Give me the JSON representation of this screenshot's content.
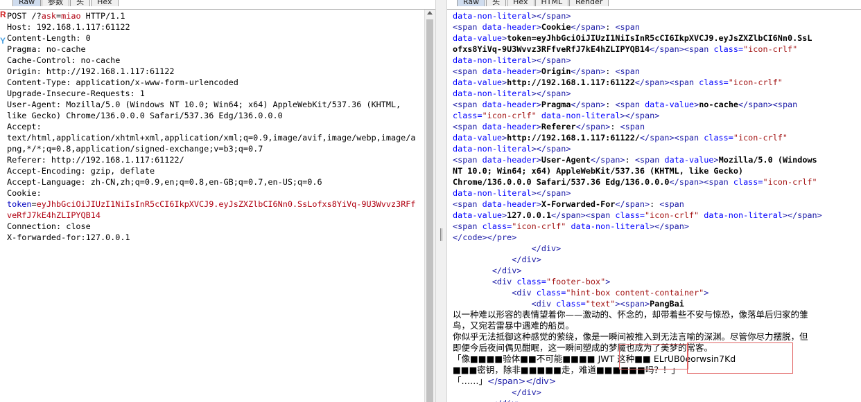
{
  "left_tabs": [
    "Raw",
    "参数",
    "头",
    "Hex"
  ],
  "right_tabs": [
    "Raw",
    "头",
    "Hex",
    "HTML",
    "Render"
  ],
  "left_edge_marks": [
    "R",
    "Y"
  ],
  "request": {
    "lines": [
      {
        "segments": [
          {
            "t": "POST /?",
            "c": ""
          },
          {
            "t": "ask",
            "c": "red"
          },
          {
            "t": "=",
            "c": ""
          },
          {
            "t": "miao",
            "c": "red"
          },
          {
            "t": " HTTP/1.1",
            "c": ""
          }
        ]
      },
      {
        "segments": [
          {
            "t": "Host: 192.168.1.117:61122",
            "c": ""
          }
        ]
      },
      {
        "segments": [
          {
            "t": "Content-Length: 0",
            "c": ""
          }
        ]
      },
      {
        "segments": [
          {
            "t": "Pragma: no-cache",
            "c": ""
          }
        ]
      },
      {
        "segments": [
          {
            "t": "Cache-Control: no-cache",
            "c": ""
          }
        ]
      },
      {
        "segments": [
          {
            "t": "Origin: http://192.168.1.117:61122",
            "c": ""
          }
        ]
      },
      {
        "segments": [
          {
            "t": "Content-Type: application/x-www-form-urlencoded",
            "c": ""
          }
        ]
      },
      {
        "segments": [
          {
            "t": "Upgrade-Insecure-Requests: 1",
            "c": ""
          }
        ]
      },
      {
        "segments": [
          {
            "t": "User-Agent: Mozilla/5.0 (Windows NT 10.0; Win64; x64) AppleWebKit/537.36 (KHTML,",
            "c": ""
          }
        ]
      },
      {
        "segments": [
          {
            "t": "like Gecko) Chrome/136.0.0.0 Safari/537.36 Edg/136.0.0.0",
            "c": ""
          }
        ]
      },
      {
        "segments": [
          {
            "t": "Accept:",
            "c": ""
          }
        ]
      },
      {
        "segments": [
          {
            "t": "text/html,application/xhtml+xml,application/xml;q=0.9,image/avif,image/webp,image/a",
            "c": ""
          }
        ]
      },
      {
        "segments": [
          {
            "t": "png,*/*;q=0.8,application/signed-exchange;v=b3;q=0.7",
            "c": ""
          }
        ]
      },
      {
        "segments": [
          {
            "t": "Referer: http://192.168.1.117:61122/",
            "c": ""
          }
        ]
      },
      {
        "segments": [
          {
            "t": "Accept-Encoding: gzip, deflate",
            "c": ""
          }
        ]
      },
      {
        "segments": [
          {
            "t": "Accept-Language: zh-CN,zh;q=0.9,en;q=0.8,en-GB;q=0.7,en-US;q=0.6",
            "c": ""
          }
        ]
      },
      {
        "segments": [
          {
            "t": "Cookie:",
            "c": ""
          }
        ]
      },
      {
        "segments": [
          {
            "t": "token",
            "c": "blue"
          },
          {
            "t": "=",
            "c": ""
          },
          {
            "t": "eyJhbGciOiJIUzI1NiIsInR5cCI6IkpXVCJ9.eyJsZXZlbCI6Nn0.SsLofxs8YiVq-9U3Wvvz3RFf",
            "c": "red"
          }
        ]
      },
      {
        "segments": [
          {
            "t": "veRfJ7kE4hZLIPYQB14",
            "c": "red"
          }
        ]
      },
      {
        "segments": [
          {
            "t": "Connection: close",
            "c": ""
          }
        ]
      },
      {
        "segments": [
          {
            "t": "X-forwarded-for:127.0.0.1",
            "c": ""
          }
        ]
      }
    ]
  },
  "response": {
    "lines": [
      {
        "indent": "",
        "segments": [
          {
            "t": "data-non-literal",
            "c": "attr"
          },
          {
            "t": "></",
            "c": "tag"
          },
          {
            "t": "span",
            "c": "tag"
          },
          {
            "t": ">",
            "c": "tag"
          }
        ]
      },
      {
        "indent": "",
        "segments": [
          {
            "t": "<span ",
            "c": "tag"
          },
          {
            "t": "data-header",
            "c": "attr"
          },
          {
            "t": ">",
            "c": "tag"
          },
          {
            "t": "Cookie",
            "c": "txt"
          },
          {
            "t": "</span>",
            "c": "tag"
          },
          {
            "t": ": ",
            "c": ""
          },
          {
            "t": "<span",
            "c": "tag"
          }
        ]
      },
      {
        "indent": "",
        "segments": [
          {
            "t": "data-value",
            "c": "attr"
          },
          {
            "t": ">",
            "c": "tag"
          },
          {
            "t": "token=eyJhbGciOiJIUzI1NiIsInR5cCI6IkpXVCJ9.eyJsZXZlbCI6Nn0.SsL",
            "c": "txt"
          }
        ]
      },
      {
        "indent": "",
        "segments": [
          {
            "t": "ofxs8YiVq-9U3Wvvz3RFfveRfJ7kE4hZLIPYQB14",
            "c": "txt"
          },
          {
            "t": "</span>",
            "c": "tag"
          },
          {
            "t": "<span ",
            "c": "tag"
          },
          {
            "t": "class=",
            "c": "attr"
          },
          {
            "t": "\"icon-crlf\"",
            "c": "str"
          }
        ]
      },
      {
        "indent": "",
        "segments": [
          {
            "t": "data-non-literal",
            "c": "attr"
          },
          {
            "t": "></span>",
            "c": "tag"
          }
        ]
      },
      {
        "indent": "",
        "segments": [
          {
            "t": "<span ",
            "c": "tag"
          },
          {
            "t": "data-header",
            "c": "attr"
          },
          {
            "t": ">",
            "c": "tag"
          },
          {
            "t": "Origin",
            "c": "txt"
          },
          {
            "t": "</span>",
            "c": "tag"
          },
          {
            "t": ": ",
            "c": ""
          },
          {
            "t": "<span",
            "c": "tag"
          }
        ]
      },
      {
        "indent": "",
        "segments": [
          {
            "t": "data-value",
            "c": "attr"
          },
          {
            "t": ">",
            "c": "tag"
          },
          {
            "t": "http://192.168.1.117:61122",
            "c": "txt"
          },
          {
            "t": "</span>",
            "c": "tag"
          },
          {
            "t": "<span ",
            "c": "tag"
          },
          {
            "t": "class=",
            "c": "attr"
          },
          {
            "t": "\"icon-crlf\"",
            "c": "str"
          }
        ]
      },
      {
        "indent": "",
        "segments": [
          {
            "t": "data-non-literal",
            "c": "attr"
          },
          {
            "t": "></span>",
            "c": "tag"
          }
        ]
      },
      {
        "indent": "",
        "segments": [
          {
            "t": "<span ",
            "c": "tag"
          },
          {
            "t": "data-header",
            "c": "attr"
          },
          {
            "t": ">",
            "c": "tag"
          },
          {
            "t": "Pragma",
            "c": "txt"
          },
          {
            "t": "</span>",
            "c": "tag"
          },
          {
            "t": ": ",
            "c": ""
          },
          {
            "t": "<span ",
            "c": "tag"
          },
          {
            "t": "data-value",
            "c": "attr"
          },
          {
            "t": ">",
            "c": "tag"
          },
          {
            "t": "no-cache",
            "c": "txt"
          },
          {
            "t": "</span>",
            "c": "tag"
          },
          {
            "t": "<span",
            "c": "tag"
          }
        ]
      },
      {
        "indent": "",
        "segments": [
          {
            "t": "class=",
            "c": "attr"
          },
          {
            "t": "\"icon-crlf\"",
            "c": "str"
          },
          {
            "t": " data-non-literal",
            "c": "attr"
          },
          {
            "t": "></span>",
            "c": "tag"
          }
        ]
      },
      {
        "indent": "",
        "segments": [
          {
            "t": "<span ",
            "c": "tag"
          },
          {
            "t": "data-header",
            "c": "attr"
          },
          {
            "t": ">",
            "c": "tag"
          },
          {
            "t": "Referer",
            "c": "txt"
          },
          {
            "t": "</span>",
            "c": "tag"
          },
          {
            "t": ": ",
            "c": ""
          },
          {
            "t": "<span",
            "c": "tag"
          }
        ]
      },
      {
        "indent": "",
        "segments": [
          {
            "t": "data-value",
            "c": "attr"
          },
          {
            "t": ">",
            "c": "tag"
          },
          {
            "t": "http://192.168.1.117:61122/",
            "c": "txt"
          },
          {
            "t": "</span>",
            "c": "tag"
          },
          {
            "t": "<span ",
            "c": "tag"
          },
          {
            "t": "class=",
            "c": "attr"
          },
          {
            "t": "\"icon-crlf\"",
            "c": "str"
          }
        ]
      },
      {
        "indent": "",
        "segments": [
          {
            "t": "data-non-literal",
            "c": "attr"
          },
          {
            "t": "></span>",
            "c": "tag"
          }
        ]
      },
      {
        "indent": "",
        "segments": [
          {
            "t": "<span ",
            "c": "tag"
          },
          {
            "t": "data-header",
            "c": "attr"
          },
          {
            "t": ">",
            "c": "tag"
          },
          {
            "t": "User-Agent",
            "c": "txt"
          },
          {
            "t": "</span>",
            "c": "tag"
          },
          {
            "t": ": ",
            "c": ""
          },
          {
            "t": "<span ",
            "c": "tag"
          },
          {
            "t": "data-value",
            "c": "attr"
          },
          {
            "t": ">",
            "c": "tag"
          },
          {
            "t": "Mozilla/5.0 (Windows",
            "c": "txt"
          }
        ]
      },
      {
        "indent": "",
        "segments": [
          {
            "t": "NT 10.0; Win64; x64) AppleWebKit/537.36 (KHTML, like Gecko)",
            "c": "txt"
          }
        ]
      },
      {
        "indent": "",
        "segments": [
          {
            "t": "Chrome/136.0.0.0 Safari/537.36 Edg/136.0.0.0",
            "c": "txt"
          },
          {
            "t": "</span>",
            "c": "tag"
          },
          {
            "t": "<span ",
            "c": "tag"
          },
          {
            "t": "class=",
            "c": "attr"
          },
          {
            "t": "\"icon-crlf\"",
            "c": "str"
          }
        ]
      },
      {
        "indent": "",
        "segments": [
          {
            "t": "data-non-literal",
            "c": "attr"
          },
          {
            "t": "></span>",
            "c": "tag"
          }
        ]
      },
      {
        "indent": "",
        "segments": [
          {
            "t": "<span ",
            "c": "tag"
          },
          {
            "t": "data-header",
            "c": "attr"
          },
          {
            "t": ">",
            "c": "tag"
          },
          {
            "t": "X-Forwarded-For",
            "c": "txt"
          },
          {
            "t": "</span>",
            "c": "tag"
          },
          {
            "t": ": ",
            "c": ""
          },
          {
            "t": "<span",
            "c": "tag"
          }
        ]
      },
      {
        "indent": "",
        "segments": [
          {
            "t": "data-value",
            "c": "attr"
          },
          {
            "t": ">",
            "c": "tag"
          },
          {
            "t": "127.0.0.1",
            "c": "txt"
          },
          {
            "t": "</span>",
            "c": "tag"
          },
          {
            "t": "<span ",
            "c": "tag"
          },
          {
            "t": "class=",
            "c": "attr"
          },
          {
            "t": "\"icon-crlf\"",
            "c": "str"
          },
          {
            "t": " data-non-literal",
            "c": "attr"
          },
          {
            "t": "></span>",
            "c": "tag"
          }
        ]
      },
      {
        "indent": "",
        "segments": [
          {
            "t": "<span ",
            "c": "tag"
          },
          {
            "t": "class=",
            "c": "attr"
          },
          {
            "t": "\"icon-crlf\"",
            "c": "str"
          },
          {
            "t": " data-non-literal",
            "c": "attr"
          },
          {
            "t": "></span>",
            "c": "tag"
          }
        ]
      },
      {
        "indent": "",
        "segments": [
          {
            "t": "</code></pre>",
            "c": "tag"
          }
        ]
      },
      {
        "indent": "                ",
        "segments": [
          {
            "t": "</div>",
            "c": "tag"
          }
        ]
      },
      {
        "indent": "            ",
        "segments": [
          {
            "t": "</div>",
            "c": "tag"
          }
        ]
      },
      {
        "indent": "        ",
        "segments": [
          {
            "t": "</div>",
            "c": "tag"
          }
        ]
      },
      {
        "indent": "        ",
        "segments": [
          {
            "t": "<div ",
            "c": "tag"
          },
          {
            "t": "class=",
            "c": "attr"
          },
          {
            "t": "\"footer-box\"",
            "c": "str"
          },
          {
            "t": ">",
            "c": "tag"
          }
        ]
      },
      {
        "indent": "            ",
        "segments": [
          {
            "t": "<div ",
            "c": "tag"
          },
          {
            "t": "class=",
            "c": "attr"
          },
          {
            "t": "\"hint-box content-container\"",
            "c": "str"
          },
          {
            "t": ">",
            "c": "tag"
          }
        ]
      },
      {
        "indent": "                ",
        "segments": [
          {
            "t": "<div ",
            "c": "tag"
          },
          {
            "t": "class=",
            "c": "attr"
          },
          {
            "t": "\"text\"",
            "c": "str"
          },
          {
            "t": ">",
            "c": "tag"
          },
          {
            "t": "<span>",
            "c": "tag"
          },
          {
            "t": "PangBai",
            "c": "txt"
          }
        ]
      },
      {
        "indent": "",
        "cjk": true,
        "segments": [
          {
            "t": "以一种难以形容的表情望着你——激动的、怀念的，却带着些不安与惊恐，像落单后归家的雏",
            "c": ""
          }
        ]
      },
      {
        "indent": "",
        "cjk": true,
        "segments": [
          {
            "t": "鸟，又宛若雷暴中遇难的船员。",
            "c": ""
          }
        ]
      },
      {
        "indent": "",
        "cjk": true,
        "segments": [
          {
            "t": "你似乎无法抵御这种感觉的萦绕，像是一瞬间被推入到无法言喻的深渊。尽管你尽力摆脱，但",
            "c": ""
          }
        ]
      },
      {
        "indent": "",
        "cjk": true,
        "segments": [
          {
            "t": "即便今后夜间偶见酣眠，这一瞬间塑成的梦魇也成为了美梦的常客。",
            "c": ""
          }
        ]
      },
      {
        "indent": "",
        "cjk": true,
        "segments": [
          {
            "t": "「像■■■■验体■■不可能■■■■ JWT 这种■■ ELrUB0eorwsin7Kd",
            "c": ""
          }
        ]
      },
      {
        "indent": "",
        "cjk": true,
        "segments": [
          {
            "t": "■■■密钥，除非■■■■■走，难道■■■■■■吗？！」",
            "c": ""
          }
        ]
      },
      {
        "indent": "",
        "cjk": true,
        "segments": [
          {
            "t": "「……」",
            "c": ""
          },
          {
            "t": "</span></div>",
            "c": "tag"
          }
        ]
      },
      {
        "indent": "            ",
        "segments": [
          {
            "t": "</div>",
            "c": "tag"
          }
        ]
      },
      {
        "indent": "        ",
        "segments": [
          {
            "t": "</div>",
            "c": "tag"
          }
        ]
      }
    ]
  }
}
